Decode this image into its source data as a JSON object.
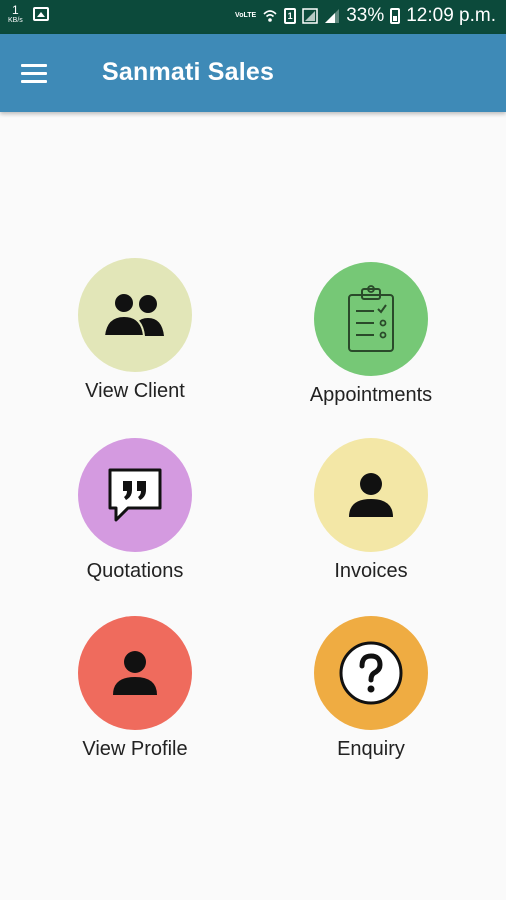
{
  "status_bar": {
    "kbs_value": "1",
    "kbs_unit": "KB/s",
    "volte": "VoLTE",
    "sim_label": "1",
    "battery": "33%",
    "time": "12:09 p.m."
  },
  "app_bar": {
    "title": "Sanmati Sales",
    "menu_icon": "hamburger-menu-icon"
  },
  "menu": [
    {
      "label": "View Client",
      "icon": "group-icon",
      "color": "#e2e6b8"
    },
    {
      "label": "Appointments",
      "icon": "clipboard-icon",
      "color": "#76c876"
    },
    {
      "label": "Quotations",
      "icon": "quote-bubble-icon",
      "color": "#d49ae0"
    },
    {
      "label": "Invoices",
      "icon": "person-icon",
      "color": "#f3e7a6"
    },
    {
      "label": "View Profile",
      "icon": "person-icon",
      "color": "#ef6b5d"
    },
    {
      "label": "Enquiry",
      "icon": "question-icon",
      "color": "#efac42"
    }
  ],
  "colors": {
    "status_bar": "#0c4a3b",
    "app_bar": "#3e8ab7",
    "background": "#fafafa"
  }
}
